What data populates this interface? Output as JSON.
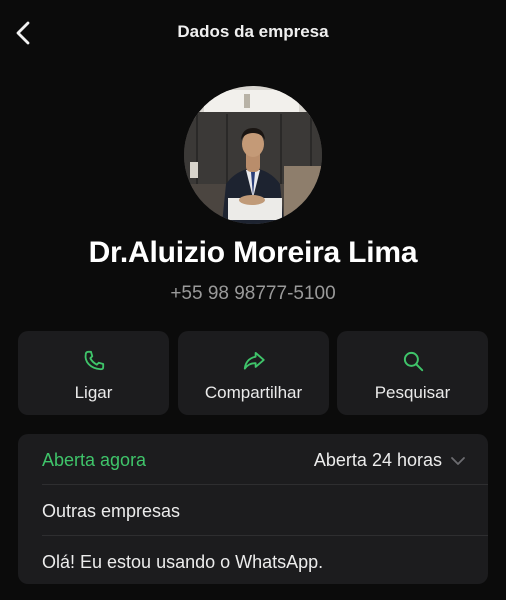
{
  "header": {
    "title": "Dados da empresa",
    "back_icon": "chevron-left-icon"
  },
  "profile": {
    "name": "Dr.Aluizio Moreira Lima",
    "phone": "+55 98 98777-5100"
  },
  "actions": [
    {
      "label": "Ligar",
      "icon": "phone-icon"
    },
    {
      "label": "Compartilhar",
      "icon": "share-arrow-icon"
    },
    {
      "label": "Pesquisar",
      "icon": "search-icon"
    }
  ],
  "info": {
    "status": "Aberta agora",
    "hours": "Aberta 24 horas",
    "other_businesses": "Outras empresas",
    "about": "Olá! Eu estou usando o WhatsApp."
  },
  "colors": {
    "background": "#0b0b0b",
    "card": "#1c1c1e",
    "accent_green": "#3fc46a",
    "muted_text": "#9a9a9a"
  }
}
